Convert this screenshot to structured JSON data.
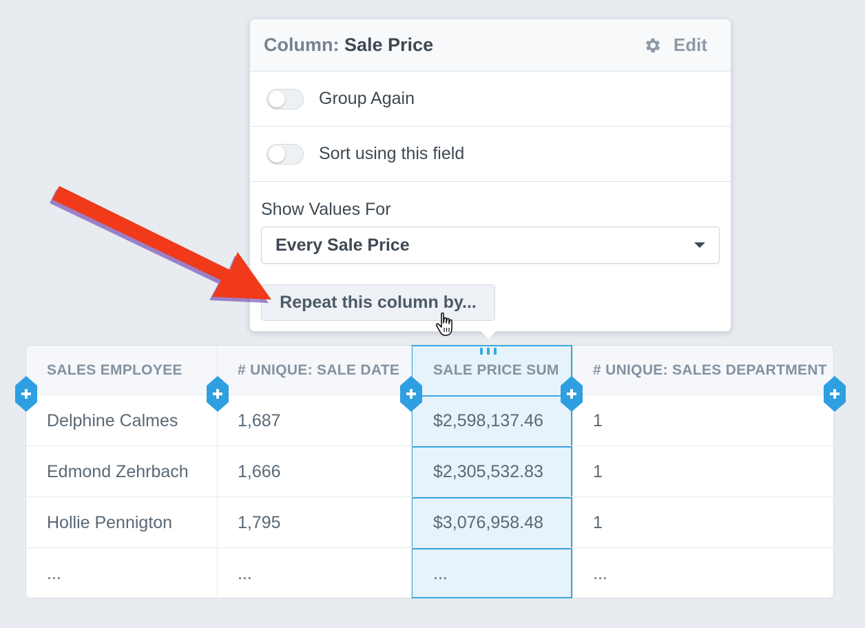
{
  "popover": {
    "title_prefix": "Column:",
    "title_name": "Sale Price",
    "edit_label": "Edit",
    "toggles": [
      {
        "label": "Group Again",
        "on": false
      },
      {
        "label": "Sort using this field",
        "on": false
      }
    ],
    "show_values_label": "Show Values For",
    "show_values_selected": "Every Sale Price",
    "repeat_button_label": "Repeat this column by..."
  },
  "table": {
    "columns": [
      "SALES EMPLOYEE",
      "# UNIQUE: SALE DATE",
      "SALE PRICE SUM",
      "# UNIQUE: SALES DEPARTMENT"
    ],
    "selected_column": "SALE PRICE SUM",
    "rows": [
      [
        "Delphine Calmes",
        "1,687",
        "$2,598,137.46",
        "1"
      ],
      [
        "Edmond Zehrbach",
        "1,666",
        "$2,305,532.83",
        "1"
      ],
      [
        "Hollie Pennigton",
        "1,795",
        "$3,076,958.48",
        "1"
      ],
      [
        "...",
        "...",
        "...",
        "..."
      ]
    ]
  },
  "colors": {
    "accent_blue": "#3aa6dd",
    "selected_column_bg": "#e6f3fb",
    "annotation_arrow": "#f03a1a"
  },
  "icons": {
    "edit": "gear-icon",
    "add_column": "plus-icon",
    "select_caret": "caret-down-icon",
    "cursor": "hand-pointer-icon",
    "annotation": "red-arrow"
  }
}
